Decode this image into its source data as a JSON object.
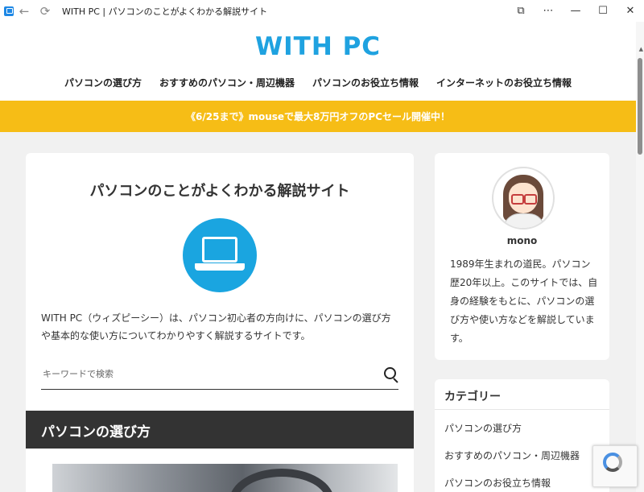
{
  "window": {
    "title": "WITH PC | パソコンのことがよくわかる解説サイト",
    "icons": [
      "app-icon",
      "back-arrow-icon",
      "refresh-icon",
      "app-install-icon",
      "more-icon",
      "minimize-icon",
      "maximize-icon",
      "close-icon"
    ]
  },
  "header": {
    "logo": "WITH PC",
    "nav": [
      {
        "label": "パソコンの選び方"
      },
      {
        "label": "おすすめのパソコン・周辺機器"
      },
      {
        "label": "パソコンのお役立ち情報"
      },
      {
        "label": "インターネットのお役立ち情報"
      }
    ]
  },
  "banner": {
    "text": "《6/25まで》mouseで最大8万円オフのPCセール開催中！",
    "color": "#f6bd16"
  },
  "main": {
    "title": "パソコンのことがよくわかる解説サイト",
    "intro": "WITH PC（ウィズピーシー）は、パソコン初心者の方向けに、パソコンの選び方や基本的な使い方についてわかりやすく解説するサイトです。",
    "search_placeholder": "キーワードで検索",
    "section_heading": "パソコンの選び方"
  },
  "profile": {
    "name": "mono",
    "bio": "1989年生まれの道民。パソコン歴20年以上。このサイトでは、自身の経験をもとに、パソコンの選び方や使い方などを解説しています。"
  },
  "categories": {
    "title": "カテゴリー",
    "items": [
      {
        "label": "パソコンの選び方"
      },
      {
        "label": "おすすめのパソコン・周辺機器"
      },
      {
        "label": "パソコンのお役立ち情報"
      }
    ]
  },
  "colors": {
    "brand": "#1fa2e0",
    "section_header_bg": "#333333"
  }
}
